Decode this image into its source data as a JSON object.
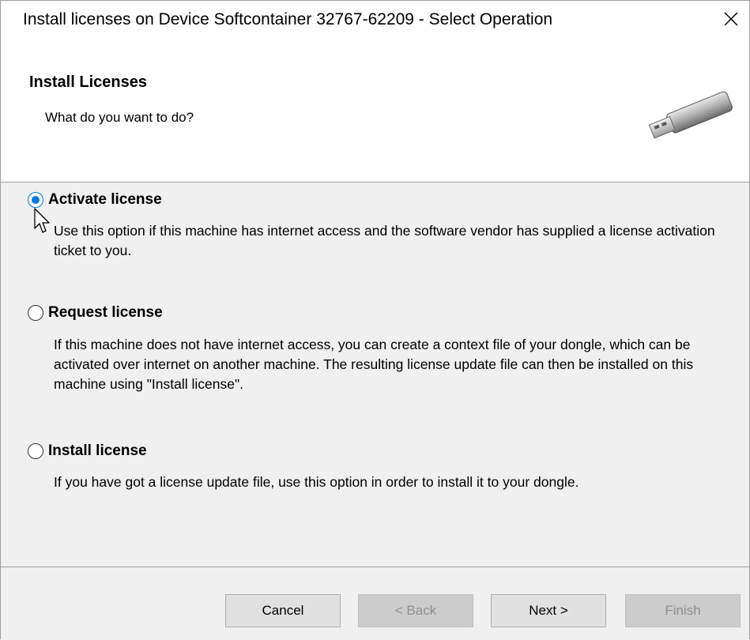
{
  "window": {
    "title": "Install licenses on Device Softcontainer 32767-62209 - Select Operation"
  },
  "header": {
    "title": "Install Licenses",
    "subtitle": "What do you want to do?",
    "icon": "usb-dongle-icon"
  },
  "options": [
    {
      "label": "Activate license",
      "selected": true,
      "description": "Use this option if this machine has internet access and the software vendor has supplied a license activation ticket to you."
    },
    {
      "label": "Request license",
      "selected": false,
      "description": "If this machine does not have internet access, you can create a context file of your dongle, which can be activated over internet on another machine. The resulting license update file can then be installed on this machine using \"Install license\"."
    },
    {
      "label": "Install license",
      "selected": false,
      "description": "If you have got a license update file, use this option in order to install it to your dongle."
    }
  ],
  "buttons": {
    "cancel": "Cancel",
    "back": "< Back",
    "next": "Next >",
    "finish": "Finish"
  },
  "colors": {
    "accent": "#0078d7",
    "background": "#f0f0f0",
    "header_background": "#ffffff"
  }
}
